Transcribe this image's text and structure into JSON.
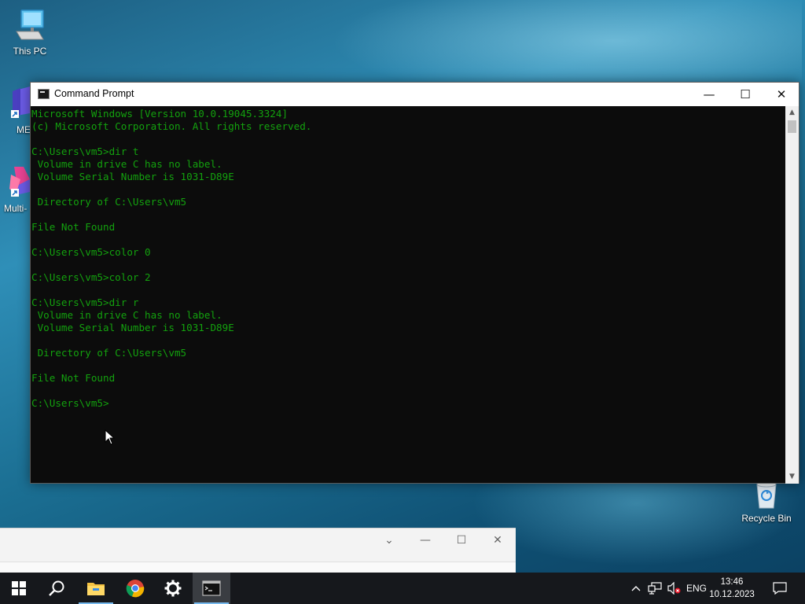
{
  "desktop": {
    "icons": [
      {
        "label": "This PC"
      },
      {
        "label": "ME"
      },
      {
        "label": "Multi-"
      },
      {
        "label": "Recycle Bin"
      }
    ]
  },
  "console_window": {
    "title": "Command Prompt",
    "text_color": "#13a10e",
    "background_color": "#0c0c0c",
    "lines": [
      "Microsoft Windows [Version 10.0.19045.3324]",
      "(c) Microsoft Corporation. All rights reserved.",
      "",
      "C:\\Users\\vm5>dir t",
      " Volume in drive C has no label.",
      " Volume Serial Number is 1031-D89E",
      "",
      " Directory of C:\\Users\\vm5",
      "",
      "File Not Found",
      "",
      "C:\\Users\\vm5>color 0",
      "",
      "C:\\Users\\vm5>color 2",
      "",
      "C:\\Users\\vm5>dir r",
      " Volume in drive C has no label.",
      " Volume Serial Number is 1031-D89E",
      "",
      " Directory of C:\\Users\\vm5",
      "",
      "File Not Found",
      "",
      "C:\\Users\\vm5>"
    ]
  },
  "taskbar": {
    "apps": [
      {
        "icon": "windows-start-icon"
      },
      {
        "icon": "search-icon"
      },
      {
        "icon": "file-explorer-icon"
      },
      {
        "icon": "chrome-icon"
      },
      {
        "icon": "settings-gear-icon"
      },
      {
        "icon": "command-prompt-icon"
      }
    ],
    "language": "ENG",
    "time": "13:46",
    "date": "10.12.2023"
  },
  "colors": {
    "taskbar_bg": "#16181c",
    "accent": "#76b9ed"
  }
}
